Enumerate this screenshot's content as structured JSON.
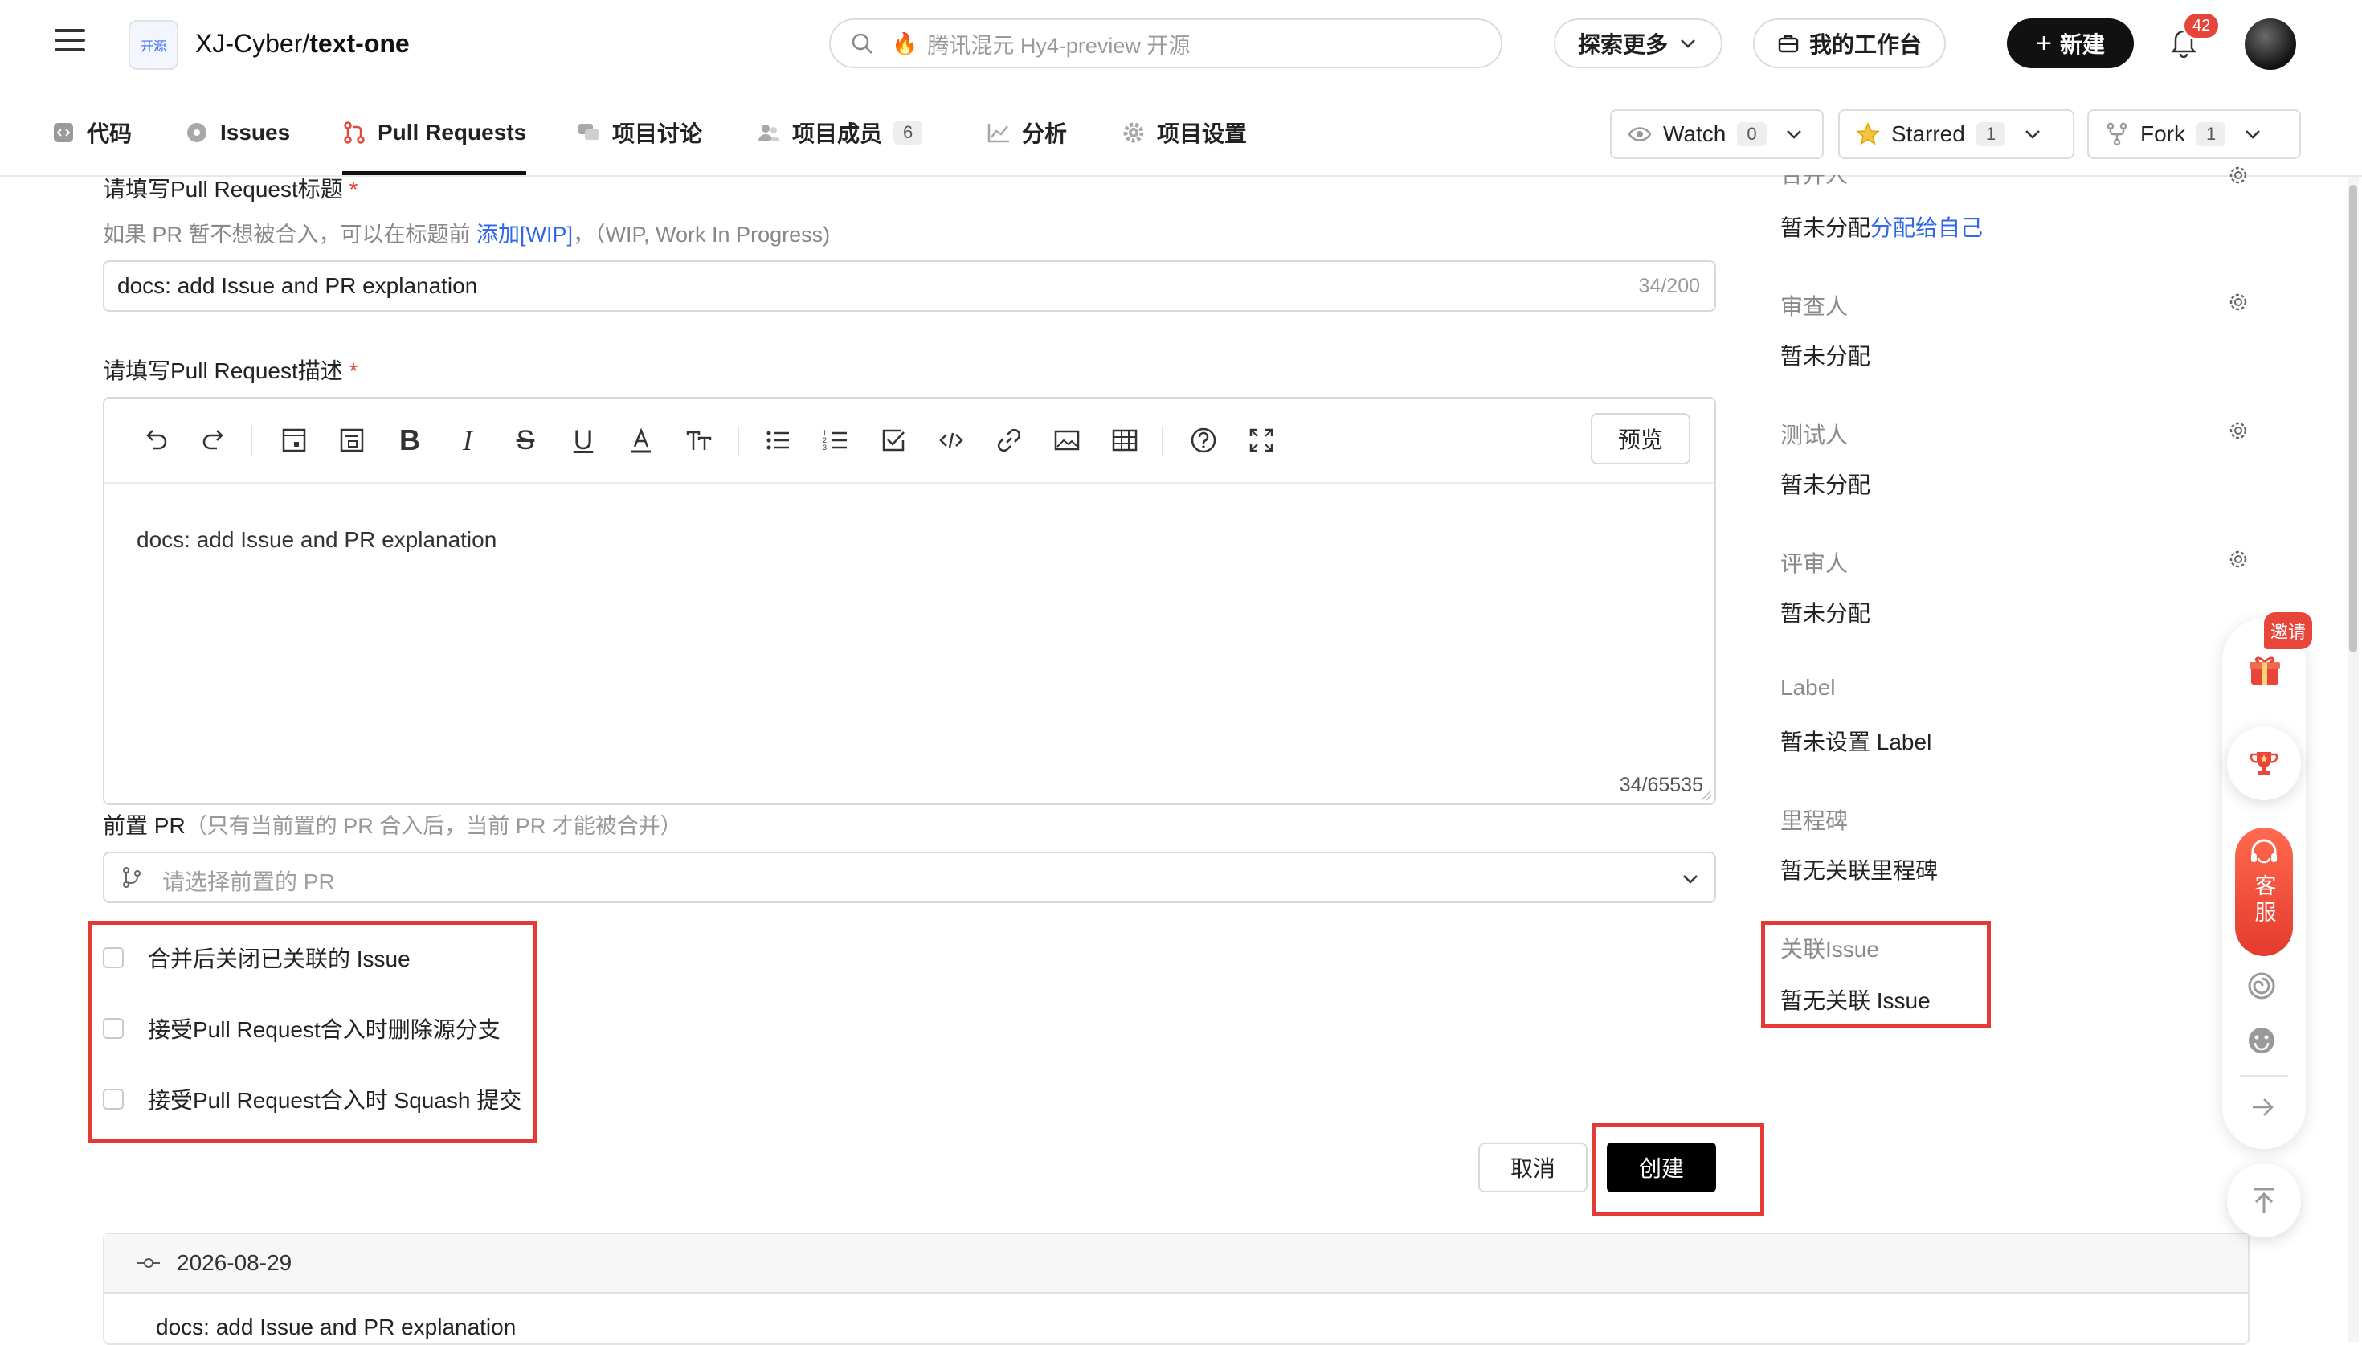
{
  "header": {
    "repo_owner": "XJ-Cyber",
    "repo_sep": "/",
    "repo_name": "text-one",
    "repo_logo_text": "开源",
    "search_placeholder": "腾讯混元 Hy4-preview 开源",
    "explore_label": "探索更多",
    "workbench_label": "我的工作台",
    "new_label": "新建",
    "notification_count": "42"
  },
  "tabs": [
    {
      "label": "代码"
    },
    {
      "label": "Issues"
    },
    {
      "label": "Pull Requests"
    },
    {
      "label": "项目讨论"
    },
    {
      "label": "项目成员",
      "count": "6"
    },
    {
      "label": "分析"
    },
    {
      "label": "项目设置"
    }
  ],
  "repo_actions": {
    "watch_label": "Watch",
    "watch_count": "0",
    "starred_label": "Starred",
    "starred_count": "1",
    "fork_label": "Fork",
    "fork_count": "1"
  },
  "form": {
    "title_label": "请填写Pull Request标题",
    "required_mark": "*",
    "title_hint_prefix": "如果 PR 暂不想被合入，可以在标题前",
    "title_hint_link": "添加[WIP]",
    "title_hint_suffix": "，（WIP, Work In Progress)",
    "title_value": "docs: add Issue and PR explanation",
    "title_counter": "34/200",
    "desc_label": "请填写Pull Request描述",
    "preview_label": "预览",
    "desc_value": "docs: add Issue and PR explanation",
    "desc_counter": "34/65535",
    "prev_pr_label": "前置 PR",
    "prev_pr_hint": "（只有当前置的 PR 合入后，当前 PR 才能被合并）",
    "prev_pr_placeholder": "请选择前置的 PR",
    "options": [
      "合并后关闭已关联的 Issue",
      "接受Pull Request合入时删除源分支",
      "接受Pull Request合入时 Squash 提交"
    ],
    "cancel_label": "取消",
    "create_label": "创建"
  },
  "commits": {
    "date": "2026-08-29",
    "first_message": "docs: add Issue and PR explanation"
  },
  "sidebar": {
    "merger_heading": "合并人",
    "merger_value": "暂未分配",
    "merger_link": "分配给自己",
    "reviewer_heading": "审查人",
    "reviewer_value": "暂未分配",
    "tester_heading": "测试人",
    "tester_value": "暂未分配",
    "approver_heading": "评审人",
    "approver_value": "暂未分配",
    "label_heading": "Label",
    "label_value": "暂未设置 Label",
    "milestone_heading": "里程碑",
    "milestone_value": "暂无关联里程碑",
    "issue_heading": "关联Issue",
    "issue_value": "暂无关联 Issue"
  },
  "floating": {
    "invite_label": "邀请",
    "service_label": "客服"
  }
}
